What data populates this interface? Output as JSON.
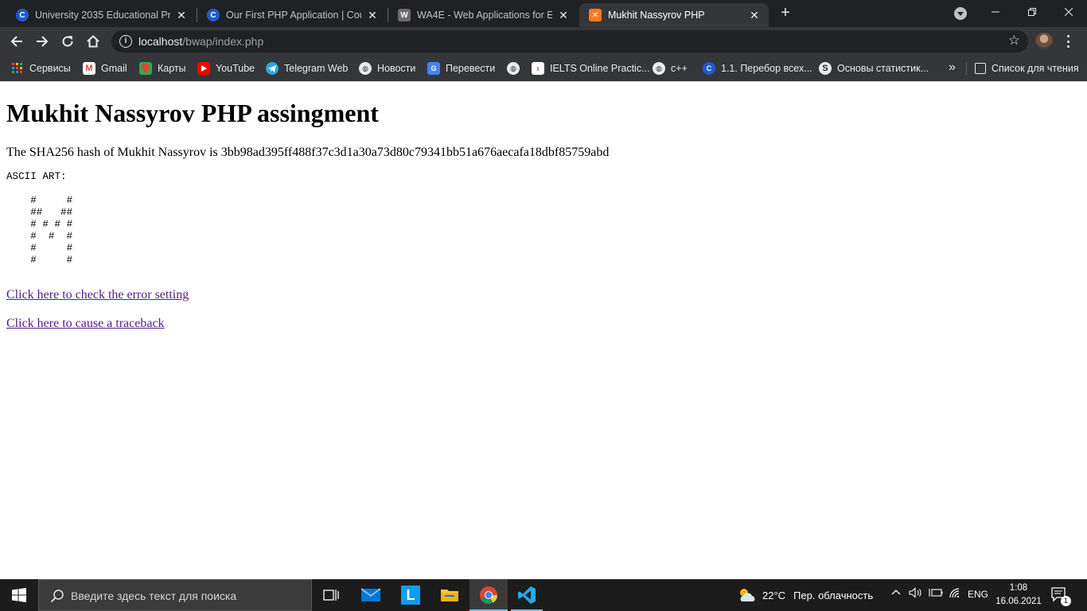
{
  "browser": {
    "tabs": [
      {
        "title": "University 2035 Educational Programs",
        "favicon": "coursera-icon"
      },
      {
        "title": "Our First PHP Application | Coursera",
        "favicon": "coursera-icon"
      },
      {
        "title": "WA4E - Web Applications for Everybody",
        "favicon": "wa4e-icon"
      },
      {
        "title": "Mukhit Nassyrov PHP",
        "favicon": "xampp-icon",
        "active": true
      }
    ],
    "address_bar": {
      "host": "localhost",
      "path": "/bwap/index.php"
    },
    "bookmarks": [
      {
        "label": "Сервисы",
        "icon": "apps-grid-icon"
      },
      {
        "label": "Gmail",
        "icon": "gmail-icon"
      },
      {
        "label": "Карты",
        "icon": "maps-icon"
      },
      {
        "label": "YouTube",
        "icon": "youtube-icon"
      },
      {
        "label": "Telegram Web",
        "icon": "telegram-icon"
      },
      {
        "label": "Новости",
        "icon": "globe-icon"
      },
      {
        "label": "Перевести",
        "icon": "translate-icon"
      },
      {
        "label": "",
        "icon": "globe-icon"
      },
      {
        "label": "IELTS Online Practic...",
        "icon": "ielts-icon"
      },
      {
        "label": "c++",
        "icon": "globe-icon"
      },
      {
        "label": "1.1. Перебор всех...",
        "icon": "coursera-icon"
      },
      {
        "label": "Основы статистик...",
        "icon": "stepik-icon"
      }
    ],
    "reading_list": "Список для чтения"
  },
  "page": {
    "heading": "Mukhit Nassyrov PHP assingment",
    "hash_text": "The SHA256 hash of Mukhit Nassyrov is 3bb98ad395ff488f37c3d1a30a73d80c79341bb51a676aecafa18dbf85759abd",
    "ascii_art": "ASCII ART:\n\n    #     #\n    ##   ##\n    # # # #\n    #  #  #\n    #     #\n    #     #",
    "links": [
      {
        "label": "Click here to check the error setting"
      },
      {
        "label": "Click here to cause a traceback"
      }
    ]
  },
  "taskbar": {
    "search_placeholder": "Введите здесь текст для поиска",
    "apps": [
      "task-view",
      "mail",
      "l-app",
      "file-explorer",
      "chrome",
      "vscode"
    ],
    "weather": {
      "temp": "22°C",
      "condition": "Пер. облачность"
    },
    "language": "ENG",
    "time": "1:08",
    "date": "16.06.2021",
    "notifications": "1"
  },
  "colors": {
    "tab_strip": "#202124",
    "toolbar": "#35363a",
    "visited_link": "#551a8b",
    "taskbar": "#1c1c1c",
    "accent": "#76b9ed"
  }
}
